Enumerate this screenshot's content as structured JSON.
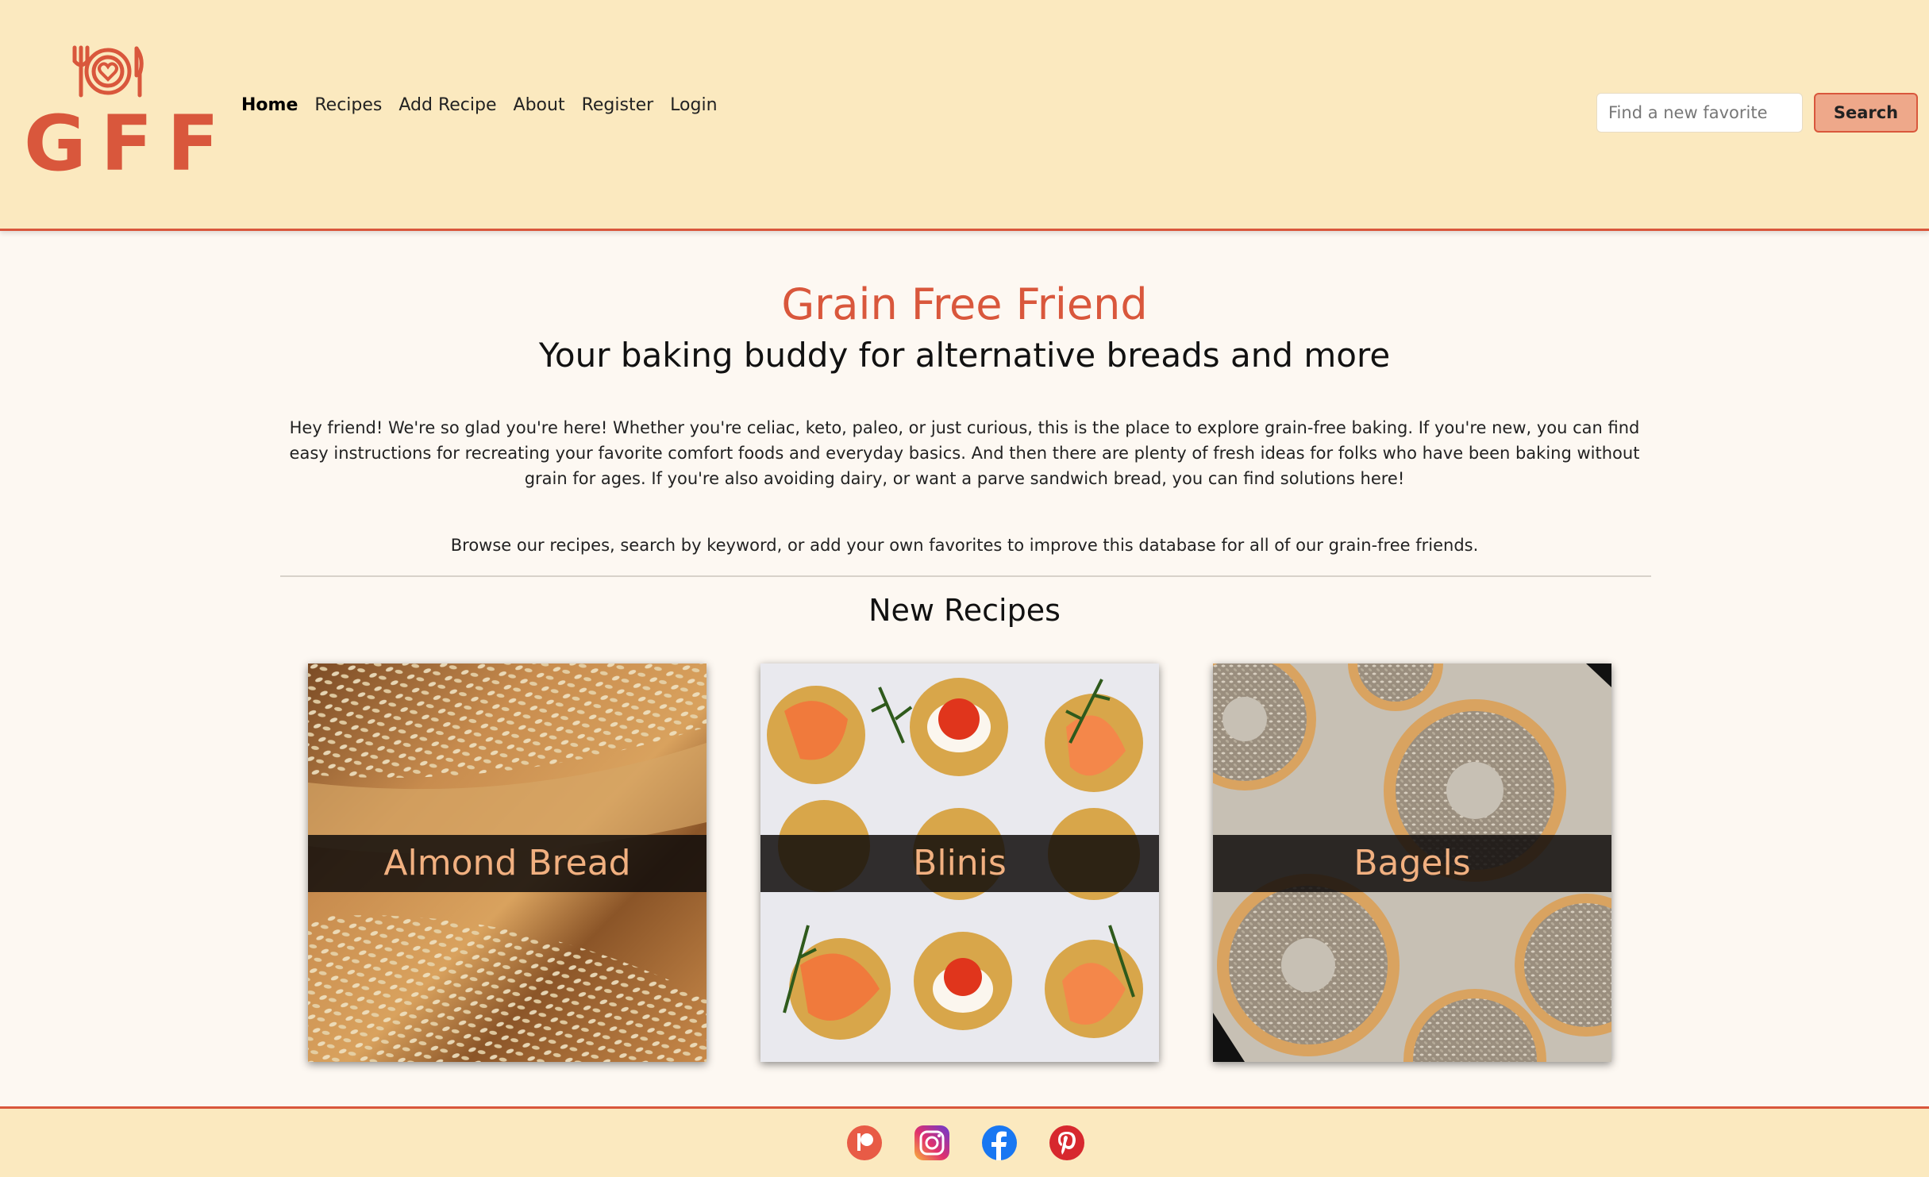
{
  "brand": {
    "logo_text": "GFF",
    "color": "#d9573c"
  },
  "nav": {
    "items": [
      {
        "label": "Home",
        "active": true
      },
      {
        "label": "Recipes"
      },
      {
        "label": "Add Recipe"
      },
      {
        "label": "About"
      },
      {
        "label": "Register"
      },
      {
        "label": "Login"
      }
    ]
  },
  "search": {
    "placeholder": "Find a new favorite",
    "button_label": "Search"
  },
  "main": {
    "title": "Grain Free Friend",
    "tagline": "Your baking buddy for alternative breads and more",
    "intro": "Hey friend! We're so glad you're here! Whether you're celiac, keto, paleo, or just curious, this is the place to explore grain-free baking. If you're new, you can find easy instructions for recreating your favorite comfort foods and everyday basics. And then there are plenty of fresh ideas for folks who have been baking without grain for ages. If you're also avoiding dairy, or want a parve sandwich bread, you can find solutions here!",
    "browse": "Browse our recipes, search by keyword, or add your own favorites to improve this database for all of our grain-free friends.",
    "new_recipes_heading": "New Recipes",
    "recipes": [
      {
        "title": "Almond Bread"
      },
      {
        "title": "Blinis"
      },
      {
        "title": "Bagels"
      }
    ]
  },
  "footer": {
    "social_icons": [
      "patreon-icon",
      "instagram-icon",
      "facebook-icon",
      "pinterest-icon"
    ]
  },
  "colors": {
    "header_bg": "#fbe9bf",
    "page_bg": "#fdf8f2",
    "accent": "#d9573c",
    "button_bg": "#eea88a",
    "card_title": "#f1b080"
  }
}
